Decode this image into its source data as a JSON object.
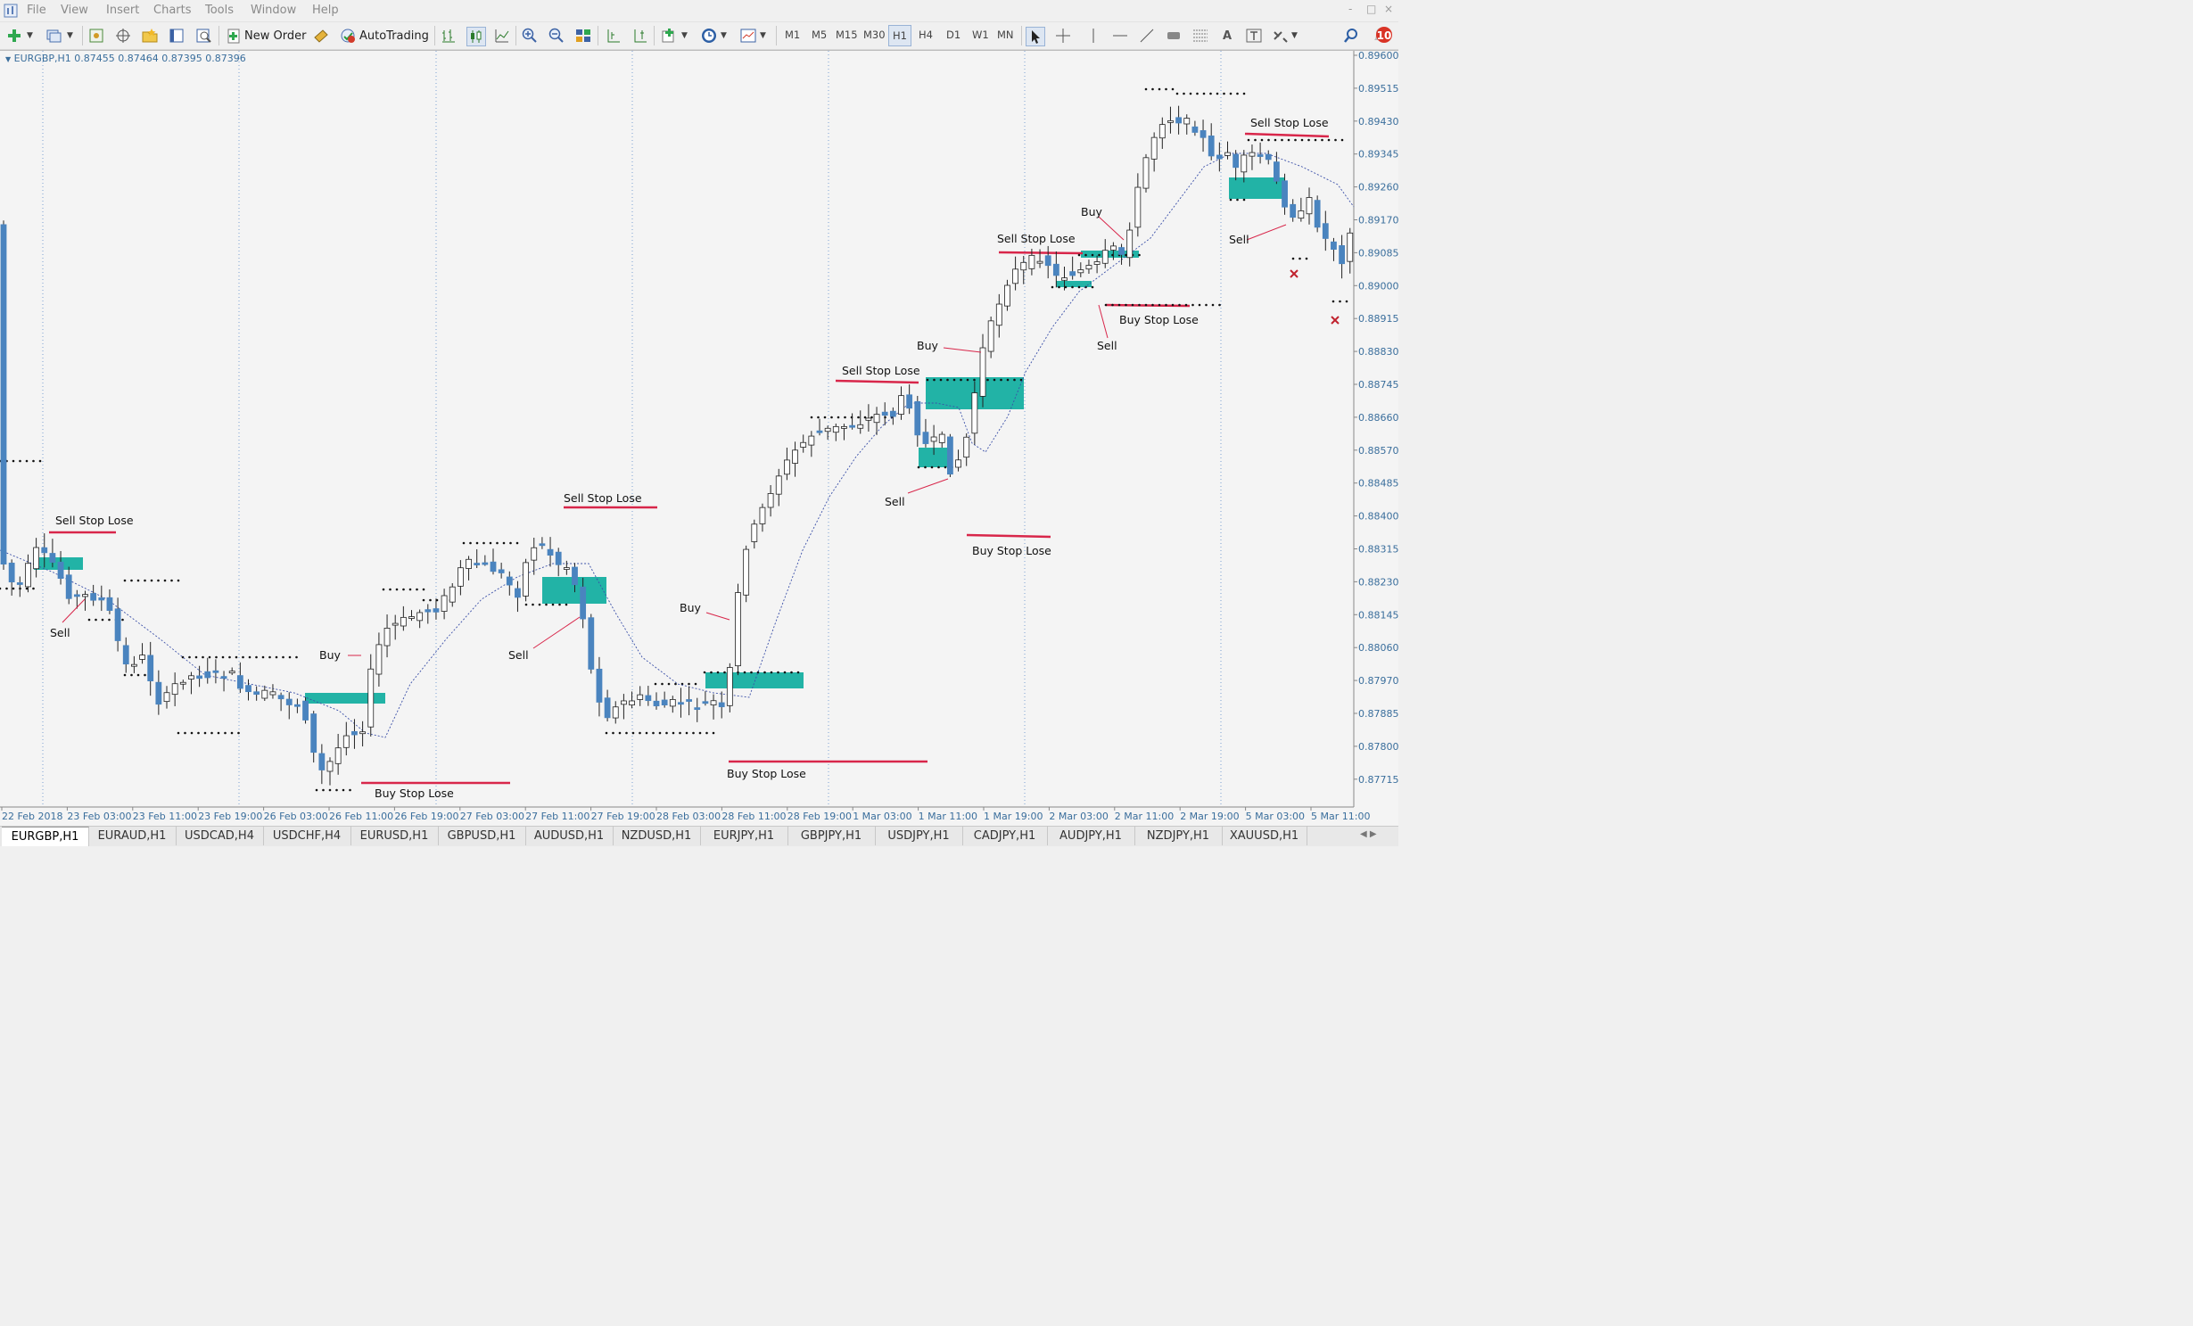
{
  "menu": {
    "items": [
      "File",
      "View",
      "Insert",
      "Charts",
      "Tools",
      "Window",
      "Help"
    ],
    "window_controls": [
      "-",
      "□",
      "×"
    ]
  },
  "toolbar": {
    "new_order_label": "New Order",
    "autotrading_label": "AutoTrading",
    "timeframes": [
      "M1",
      "M5",
      "M15",
      "M30",
      "H1",
      "H4",
      "D1",
      "W1",
      "MN"
    ],
    "active_timeframe": "H1",
    "notification_count": "10"
  },
  "chart": {
    "symbol_info": "EURGBP,H1  0.87455 0.87464 0.87395 0.87396",
    "price_labels": [
      "0.89600",
      "0.89515",
      "0.89430",
      "0.89345",
      "0.89260",
      "0.89170",
      "0.89085",
      "0.89000",
      "0.88915",
      "0.88830",
      "0.88745",
      "0.88660",
      "0.88570",
      "0.88485",
      "0.88400",
      "0.88315",
      "0.88230",
      "0.88145",
      "0.88060",
      "0.87970",
      "0.87885",
      "0.87800",
      "0.87715"
    ],
    "time_labels": [
      "22 Feb 2018",
      "23 Feb 03:00",
      "23 Feb 11:00",
      "23 Feb 19:00",
      "26 Feb 03:00",
      "26 Feb 11:00",
      "26 Feb 19:00",
      "27 Feb 03:00",
      "27 Feb 11:00",
      "27 Feb 19:00",
      "28 Feb 03:00",
      "28 Feb 11:00",
      "28 Feb 19:00",
      "1 Mar 03:00",
      "1 Mar 11:00",
      "1 Mar 19:00",
      "2 Mar 03:00",
      "2 Mar 11:00",
      "2 Mar 19:00",
      "5 Mar 03:00",
      "5 Mar 11:00"
    ],
    "annotations": {
      "sell_stop_lose": "Sell Stop Lose",
      "buy_stop_lose": "Buy Stop Lose",
      "buy": "Buy",
      "sell": "Sell"
    },
    "colors": {
      "bull_candle": "#ffffff",
      "bear_candle": "#4a84bf",
      "zone": "#22b3a6",
      "stop_line": "#d8264a",
      "ma_line": "#3a4fa8"
    }
  },
  "tabs": [
    "EURGBP,H1",
    "EURAUD,H1",
    "USDCAD,H4",
    "USDCHF,H4",
    "EURUSD,H1",
    "GBPUSD,H1",
    "AUDUSD,H1",
    "NZDUSD,H1",
    "EURJPY,H1",
    "GBPJPY,H1",
    "USDJPY,H1",
    "CADJPY,H1",
    "AUDJPY,H1",
    "NZDJPY,H1",
    "XAUUSD,H1"
  ],
  "active_tab": "EURGBP,H1"
}
